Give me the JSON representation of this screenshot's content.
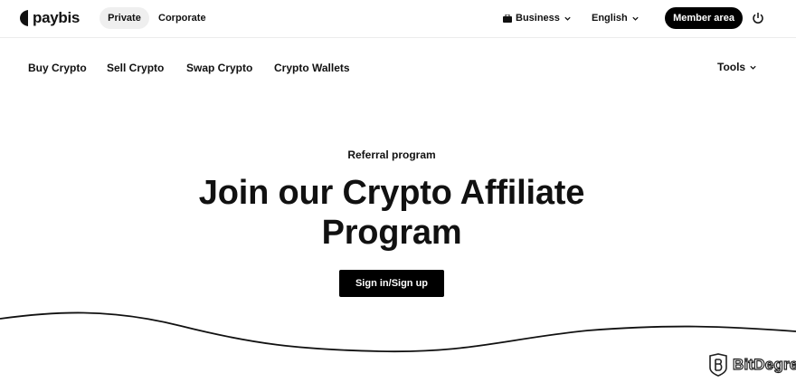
{
  "header": {
    "logo_text": "paybis",
    "segments": {
      "private": "Private",
      "corporate": "Corporate"
    },
    "business_label": "Business",
    "language_label": "English",
    "member_area_label": "Member area"
  },
  "nav": {
    "items": [
      "Buy Crypto",
      "Sell Crypto",
      "Swap Crypto",
      "Crypto Wallets"
    ],
    "tools_label": "Tools"
  },
  "hero": {
    "eyebrow": "Referral program",
    "title_line1": "Join our Crypto Affiliate",
    "title_line2": "Program",
    "cta_label": "Sign in/Sign up"
  },
  "watermark": {
    "text": "BitDegree"
  },
  "icons": {
    "logo": "paybis-logo-icon",
    "briefcase": "briefcase-icon",
    "chevron": "chevron-down-icon",
    "power": "power-icon",
    "watermark": "bitdegree-logo-icon"
  },
  "colors": {
    "primary": "#000000",
    "background": "#ffffff",
    "segment_active_bg": "#efefef"
  }
}
